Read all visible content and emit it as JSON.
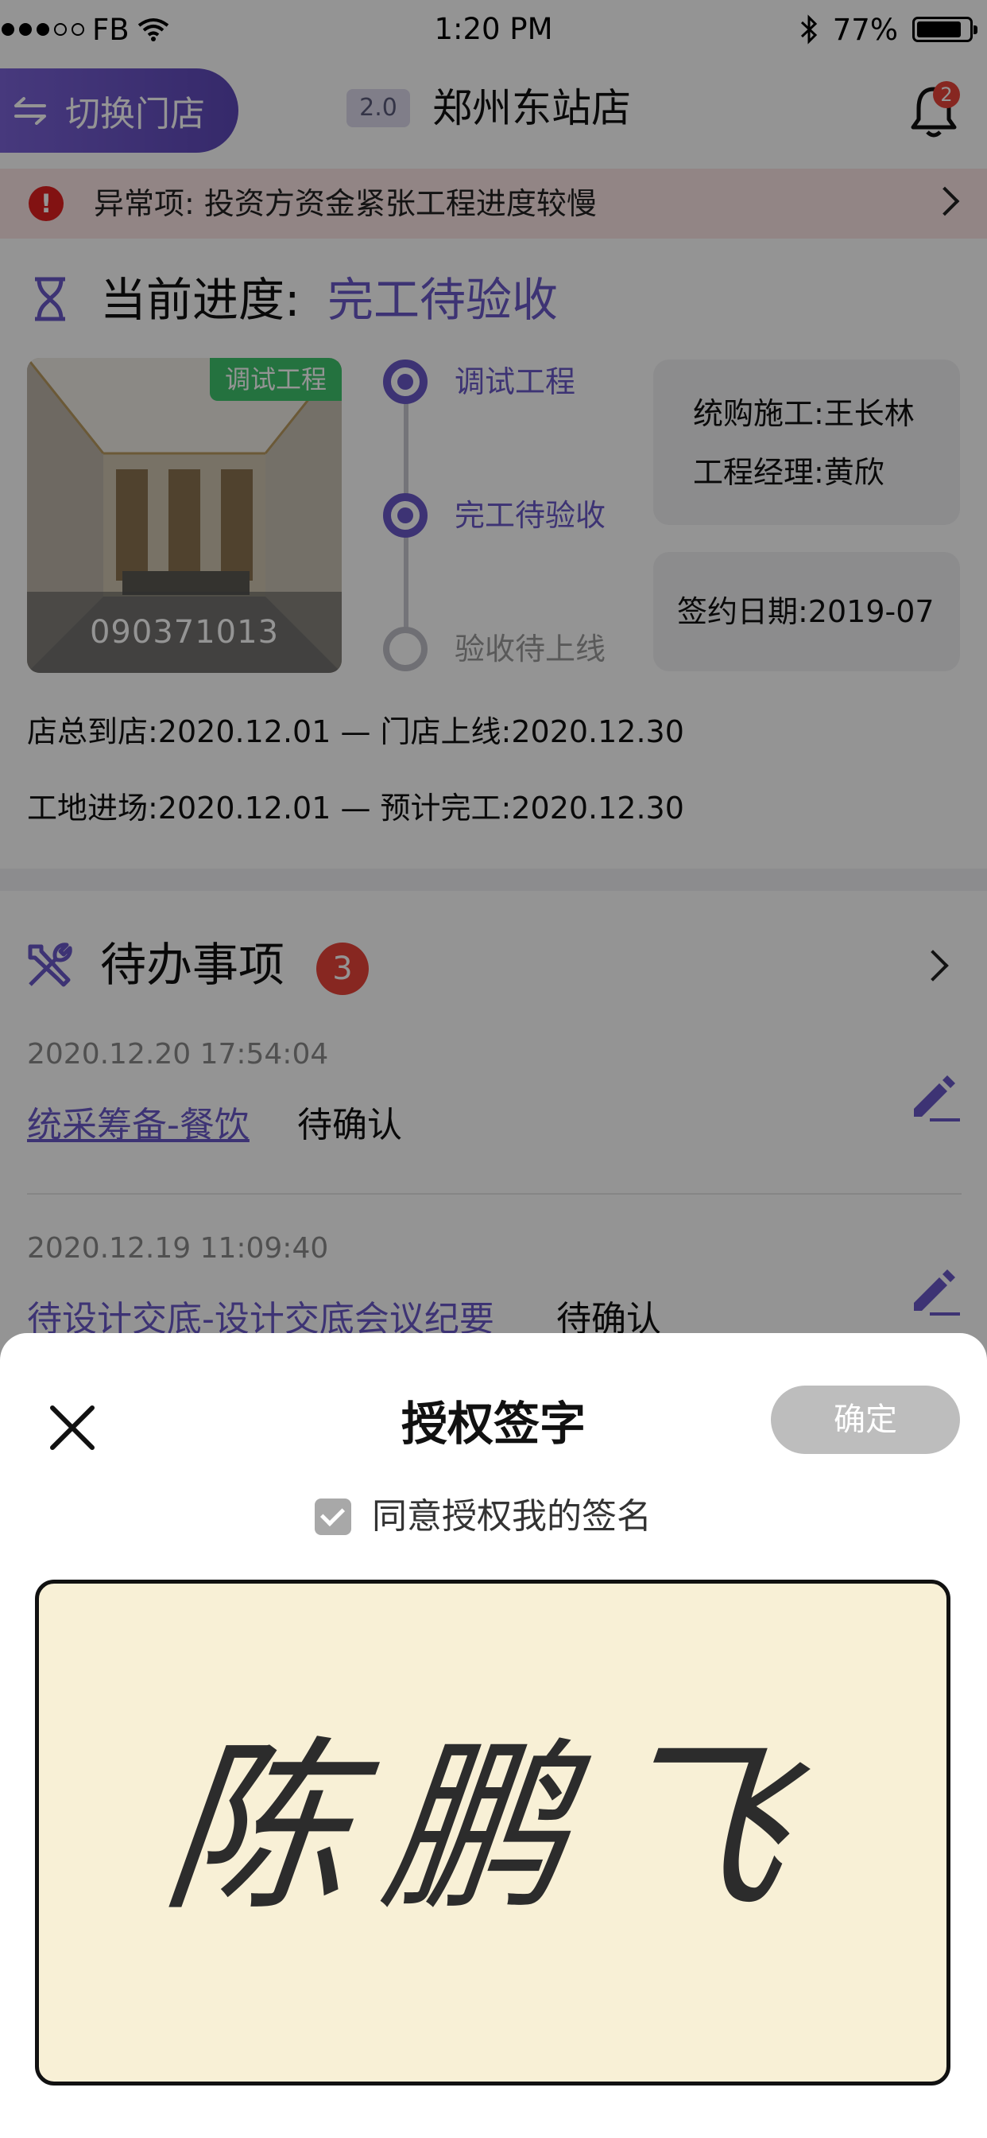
{
  "status_bar": {
    "carrier": "FB",
    "time": "1:20 PM",
    "battery": "77%",
    "battery_level": 0.77,
    "signal_dots": [
      true,
      true,
      true,
      false,
      false
    ]
  },
  "header": {
    "switch_label": "切换门店",
    "version": "2.0",
    "store_name": "郑州东站店",
    "notification_count": "2"
  },
  "alert": {
    "text": "异常项: 投资方资金紧张工程进度较慢"
  },
  "progress": {
    "title": "当前进度:",
    "value": "完工待验收",
    "photo_tag": "调试工程",
    "photo_code": "090371013",
    "timeline": [
      {
        "label": "调试工程",
        "active": true
      },
      {
        "label": "完工待验收",
        "active": true
      },
      {
        "label": "验收待上线",
        "active": false
      }
    ],
    "card1": {
      "line1": "统购施工:王长林",
      "line2": "工程经理:黄欣"
    },
    "card2": {
      "line1": "签约日期:2019-07"
    },
    "dates": {
      "row1": "店总到店:2020.12.01 — 门店上线:2020.12.30",
      "row2": "工地进场:2020.12.01 — 预计完工:2020.12.30"
    }
  },
  "todo": {
    "title": "待办事项",
    "count": "3",
    "items": [
      {
        "time": "2020.12.20 17:54:04",
        "link": "统采筹备-餐饮",
        "status": "待确认"
      },
      {
        "time": "2020.12.19 11:09:40",
        "link": "待设计交底-设计交底会议纪要",
        "status": "待确认"
      }
    ]
  },
  "modal": {
    "title": "授权签字",
    "confirm": "确定",
    "agree_text": "同意授权我的签名",
    "agree_checked": true,
    "signature": "陈鹏飞"
  },
  "colors": {
    "accent": "#6a58c8",
    "alert_bg": "#fbe6e6",
    "badge": "#e8443a",
    "tag": "#3ec46d",
    "sign_pad": "#f8f0d6"
  }
}
